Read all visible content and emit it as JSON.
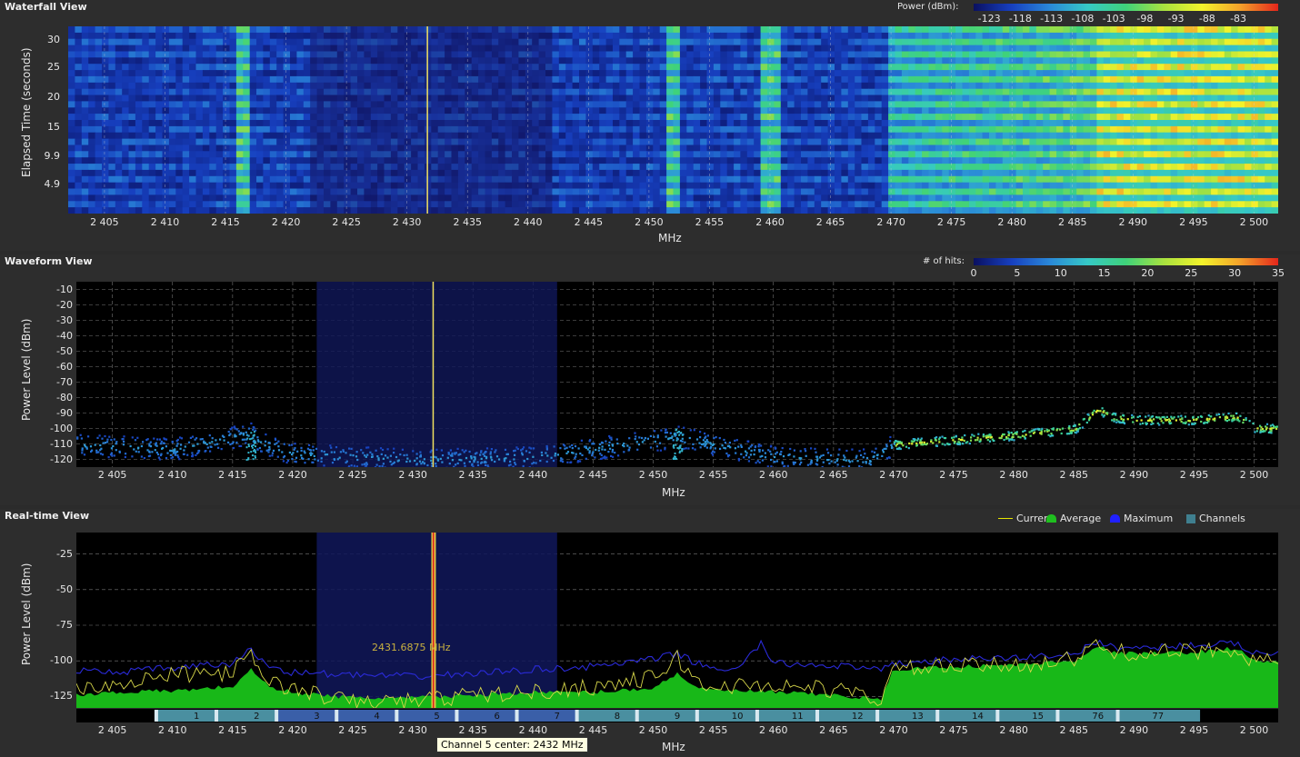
{
  "waterfall": {
    "title": "Waterfall View",
    "colorbar_label": "Power (dBm):",
    "colorbar_ticks": [
      "-123",
      "-118",
      "-113",
      "-108",
      "-103",
      "-98",
      "-93",
      "-88",
      "-83"
    ],
    "y_label": "Elapsed Time (seconds)",
    "y_ticks": [
      "30",
      "25",
      "20",
      "15",
      "9.9",
      "4.9"
    ],
    "x_label": "MHz"
  },
  "waveform": {
    "title": "Waveform View",
    "colorbar_label": "# of hits:",
    "colorbar_ticks": [
      "0",
      "5",
      "10",
      "15",
      "20",
      "25",
      "30",
      "35"
    ],
    "y_label": "Power Level (dBm)",
    "y_ticks": [
      "-10",
      "-20",
      "-30",
      "-40",
      "-50",
      "-60",
      "-70",
      "-80",
      "-90",
      "-100",
      "-110",
      "-120"
    ],
    "x_label": "MHz"
  },
  "realtime": {
    "title": "Real-time View",
    "y_label": "Power Level (dBm)",
    "y_ticks": [
      "-25",
      "-50",
      "-75",
      "-100",
      "-125"
    ],
    "x_label": "MHz",
    "marker_label": "2431.6875 MHz",
    "legend": [
      {
        "label": "Current",
        "color": "#e6e600"
      },
      {
        "label": "Average",
        "color": "#1fbf1f"
      },
      {
        "label": "Maximum",
        "color": "#2020ff"
      },
      {
        "label": "Channels",
        "color": "#3f7f8f"
      }
    ],
    "channels": [
      "1",
      "2",
      "3",
      "4",
      "5",
      "6",
      "7",
      "8",
      "9",
      "10",
      "11",
      "12",
      "13",
      "14",
      "15",
      "76",
      "77"
    ]
  },
  "x_ticks": [
    "2 405",
    "2 410",
    "2 415",
    "2 420",
    "2 425",
    "2 430",
    "2 435",
    "2 440",
    "2 445",
    "2 450",
    "2 455",
    "2 460",
    "2 465",
    "2 470",
    "2 475",
    "2 480",
    "2 485",
    "2 490",
    "2 495",
    "2 500"
  ],
  "tooltip": "Channel 5 center: 2432 MHz",
  "chart_data": [
    {
      "type": "heatmap",
      "title": "Waterfall View",
      "xlabel": "MHz",
      "ylabel": "Elapsed Time (seconds)",
      "xlim": [
        2402,
        2502
      ],
      "ylim": [
        0,
        32
      ],
      "colorbar": {
        "label": "Power (dBm):",
        "range": [
          -123,
          -80
        ]
      },
      "hotspots_mhz": [
        2416.5,
        2452,
        2460,
        2487
      ],
      "band_2470_2502_dbm": -95
    },
    {
      "type": "scatter",
      "title": "Waveform View",
      "xlabel": "MHz",
      "ylabel": "Power Level (dBm)",
      "xlim": [
        2402,
        2502
      ],
      "ylim": [
        -125,
        -5
      ],
      "colorbar": {
        "label": "# of hits:",
        "range": [
          0,
          35
        ]
      },
      "series": [
        {
          "name": "signal",
          "x": [
            2402,
            2410,
            2416.5,
            2417,
            2420,
            2430,
            2440,
            2452,
            2460,
            2468,
            2470,
            2475,
            2480,
            2485,
            2487,
            2488,
            2490,
            2495,
            2498.5,
            2500,
            2502
          ],
          "y": [
            -110,
            -113,
            -103,
            -108,
            -116,
            -120,
            -118,
            -105,
            -118,
            -120,
            -110,
            -107,
            -104,
            -100,
            -87,
            -92,
            -94,
            -94,
            -92,
            -99,
            -100
          ]
        }
      ]
    },
    {
      "type": "line",
      "title": "Real-time View",
      "xlabel": "MHz",
      "ylabel": "Power Level (dBm)",
      "xlim": [
        2402,
        2502
      ],
      "ylim": [
        -133,
        -10
      ],
      "series": [
        {
          "name": "Average",
          "x": [
            2402,
            2405,
            2410,
            2415,
            2416.5,
            2418,
            2420,
            2425,
            2430,
            2435,
            2440,
            2445,
            2450,
            2452,
            2454,
            2460,
            2465,
            2469,
            2470,
            2475,
            2480,
            2485,
            2487,
            2488,
            2490,
            2495,
            2498.5,
            2500,
            2502
          ],
          "y": [
            -124,
            -122,
            -121,
            -118,
            -106,
            -118,
            -122,
            -126,
            -126,
            -124,
            -122,
            -122,
            -119,
            -109,
            -120,
            -122,
            -124,
            -127,
            -106,
            -104,
            -103,
            -100,
            -89,
            -94,
            -95,
            -94,
            -91,
            -100,
            -101
          ]
        },
        {
          "name": "Maximum",
          "x": [
            2402,
            2405,
            2410,
            2415,
            2416.5,
            2418,
            2420,
            2425,
            2430,
            2435,
            2440,
            2445,
            2450,
            2452,
            2454,
            2457,
            2459,
            2460,
            2465,
            2469,
            2470,
            2475,
            2480,
            2485,
            2487,
            2488,
            2490,
            2495,
            2498.5,
            2500,
            2502
          ],
          "y": [
            -107,
            -108,
            -105,
            -102,
            -92,
            -104,
            -108,
            -110,
            -111,
            -109,
            -106,
            -104,
            -99,
            -95,
            -103,
            -107,
            -87,
            -102,
            -103,
            -107,
            -102,
            -99,
            -98,
            -95,
            -87,
            -90,
            -91,
            -89,
            -88,
            -94,
            -95
          ]
        },
        {
          "name": "Current",
          "x": [
            2402,
            2405,
            2410,
            2415,
            2416.5,
            2418,
            2420,
            2425,
            2430,
            2435,
            2440,
            2445,
            2450,
            2452,
            2454,
            2460,
            2465,
            2469,
            2470,
            2475,
            2480,
            2485,
            2487,
            2488,
            2490,
            2495,
            2498.5,
            2500,
            2502
          ],
          "y": [
            -118,
            -116,
            -110,
            -108,
            -97,
            -114,
            -120,
            -129,
            -128,
            -124,
            -122,
            -118,
            -112,
            -98,
            -118,
            -117,
            -120,
            -127,
            -106,
            -104,
            -103,
            -99,
            -89,
            -94,
            -94,
            -94,
            -91,
            -100,
            -101
          ]
        }
      ],
      "marker_mhz": 2431.6875,
      "highlight_range_mhz": [
        2422,
        2442
      ],
      "channels": [
        "1",
        "2",
        "3",
        "4",
        "5",
        "6",
        "7",
        "8",
        "9",
        "10",
        "11",
        "12",
        "13",
        "14",
        "15",
        "76",
        "77"
      ]
    }
  ]
}
